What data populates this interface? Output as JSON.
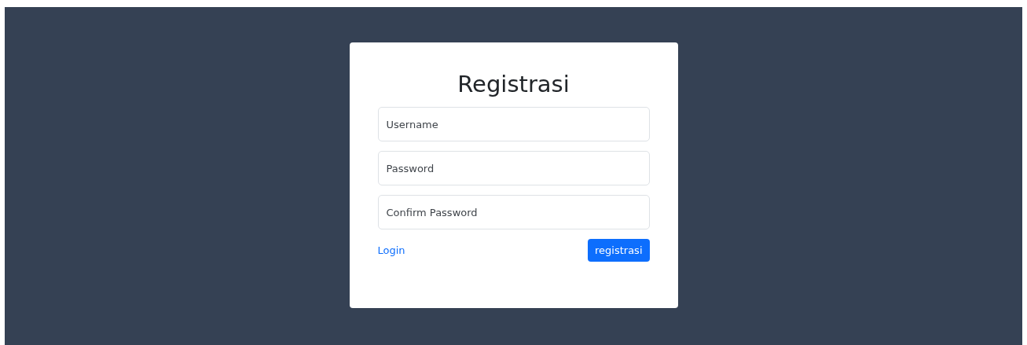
{
  "title": "Registrasi",
  "fields": [
    {
      "placeholder": "Username"
    },
    {
      "placeholder": "Password"
    },
    {
      "placeholder": "Confirm Password"
    }
  ],
  "login_link": "Login",
  "submit_button": "registrasi"
}
